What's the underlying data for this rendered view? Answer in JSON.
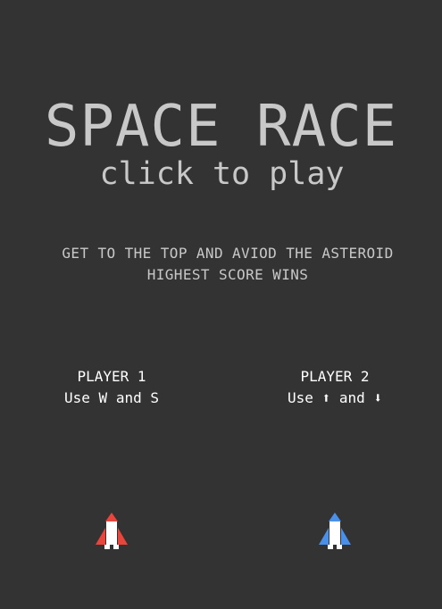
{
  "game": {
    "title": "SPACE RACE",
    "subtitle": "click to play",
    "instructions": [
      "GET TO THE TOP AND AVIOD THE ASTEROID",
      "HIGHEST SCORE WINS"
    ]
  },
  "players": [
    {
      "label": "PLAYER 1",
      "controls": "Use W and S",
      "ship_color": "#e8453c",
      "ship_icon": "rocket-icon"
    },
    {
      "label": "PLAYER 2",
      "controls": "Use ⬆ and ⬇",
      "ship_color": "#4a8fe8",
      "ship_icon": "rocket-icon"
    }
  ],
  "colors": {
    "background": "#333333",
    "title_text": "#c8c8c8",
    "player_text": "#ffffff",
    "ship_body": "#ffffff"
  }
}
